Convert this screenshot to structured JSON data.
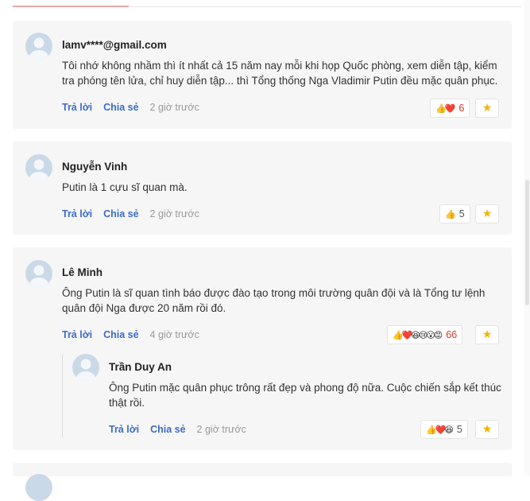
{
  "comments": [
    {
      "author": "lamv****@gmail.com",
      "text": "Tôi nhớ không nhầm thì ít nhất cả 15 năm nay mỗi khi họp Quốc phòng, xem diễn tập, kiểm tra phóng tên lửa, chỉ huy diễn tập... thì Tổng thống Nga Vladimir Putin đều mặc quân phục.",
      "reply_label": "Trả lời",
      "share_label": "Chia sẻ",
      "time": "2 giờ trước",
      "reactions": "👍❤️",
      "count": "6",
      "star": "★"
    },
    {
      "author": "Nguyễn Vinh",
      "text": "Putin là 1 cựu sĩ quan mà.",
      "reply_label": "Trả lời",
      "share_label": "Chia sẻ",
      "time": "2 giờ trước",
      "reactions": "👍",
      "count": "5",
      "star": "★"
    },
    {
      "author": "Lê Minh",
      "text": "Ông Putin là sĩ quan tình báo được đào tạo trong môi trường quân đội và là Tổng tư lệnh quân đội Nga được 20 năm rồi đó.",
      "reply_label": "Trả lời",
      "share_label": "Chia sẻ",
      "time": "4 giờ trước",
      "reactions": "👍❤️😆😢😮😡",
      "count": "66",
      "star": "★",
      "reply": {
        "author": "Trần Duy An",
        "text": "Ông Putin mặc quân phục trông rất đẹp và phong độ nữa. Cuộc chiến sắp kết thúc thật rồi.",
        "reply_label": "Trả lời",
        "share_label": "Chia sẻ",
        "time": "2 giờ trước",
        "reactions": "👍❤️😆",
        "count": "5",
        "star": "★"
      }
    }
  ]
}
